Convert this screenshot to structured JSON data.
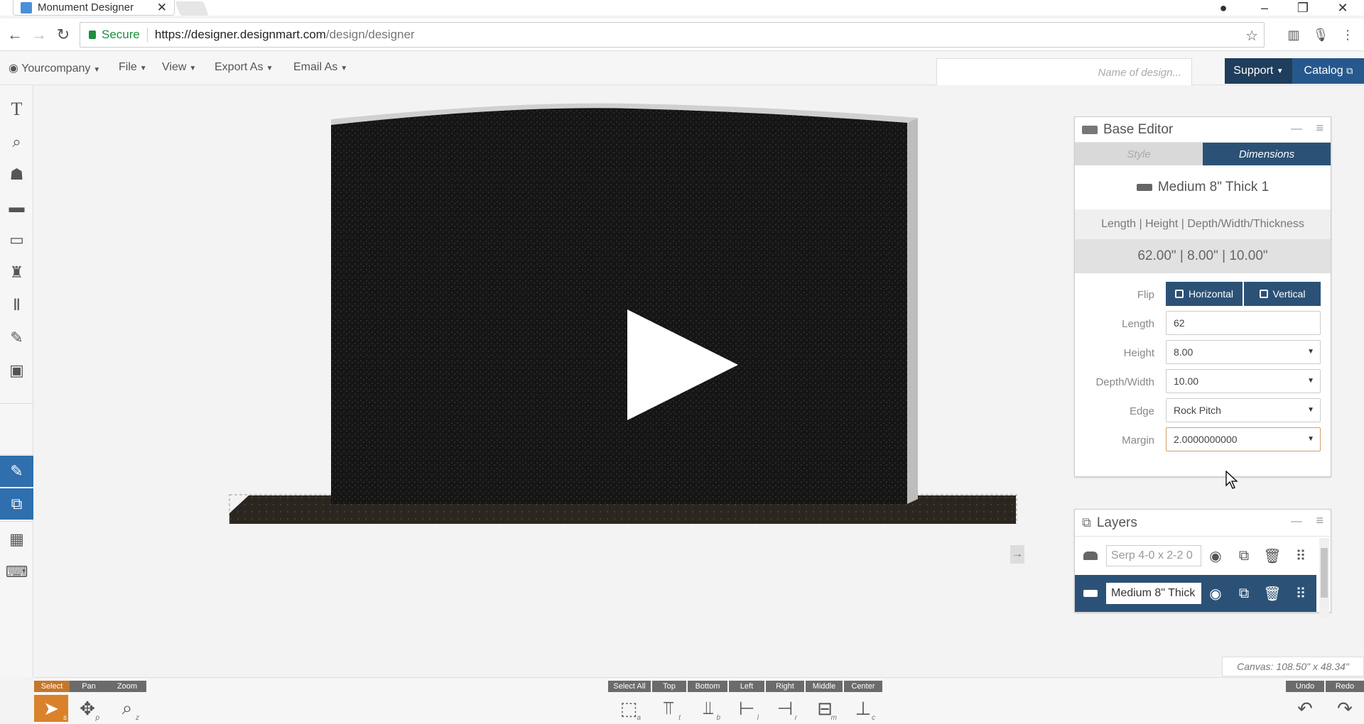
{
  "browser": {
    "tab_title": "Monument Designer",
    "url_secure_label": "Secure",
    "url_host": "https://designer.designmart.com",
    "url_path": "/design/designer"
  },
  "menu": {
    "company": "Yourcompany",
    "file": "File",
    "view": "View",
    "export_as": "Export As",
    "email_as": "Email As",
    "design_name_placeholder": "Name of design...",
    "support": "Support",
    "catalog": "Catalog"
  },
  "base_editor": {
    "title": "Base Editor",
    "tab_style": "Style",
    "tab_dimensions": "Dimensions",
    "base_name": "Medium 8\" Thick 1",
    "dim_header": "Length | Height | Depth/Width/Thickness",
    "dim_values": "62.00\" | 8.00\" | 10.00\"",
    "flip_label": "Flip",
    "flip_horizontal": "Horizontal",
    "flip_vertical": "Vertical",
    "length_label": "Length",
    "length_value": "62",
    "height_label": "Height",
    "height_value": "8.00",
    "depth_label": "Depth/Width",
    "depth_value": "10.00",
    "edge_label": "Edge",
    "edge_value": "Rock Pitch",
    "margin_label": "Margin",
    "margin_value": "2.0000000000"
  },
  "layers": {
    "title": "Layers",
    "items": [
      {
        "name": "Serp 4-0 x 2-2 0"
      },
      {
        "name": "Medium 8\" Thick"
      }
    ]
  },
  "bottom": {
    "select": "Select",
    "pan": "Pan",
    "zoom": "Zoom",
    "select_all": "Select All",
    "top": "Top",
    "bottom": "Bottom",
    "left": "Left",
    "right": "Right",
    "middle": "Middle",
    "center": "Center",
    "undo": "Undo",
    "redo": "Redo",
    "canvas_size": "Canvas: 108.50\" x 48.34\""
  },
  "colors": {
    "accent_dark": "#2b5276",
    "accent_orange": "#d9822b",
    "support_bg": "#1f3d5c",
    "catalog_bg": "#27588d"
  }
}
